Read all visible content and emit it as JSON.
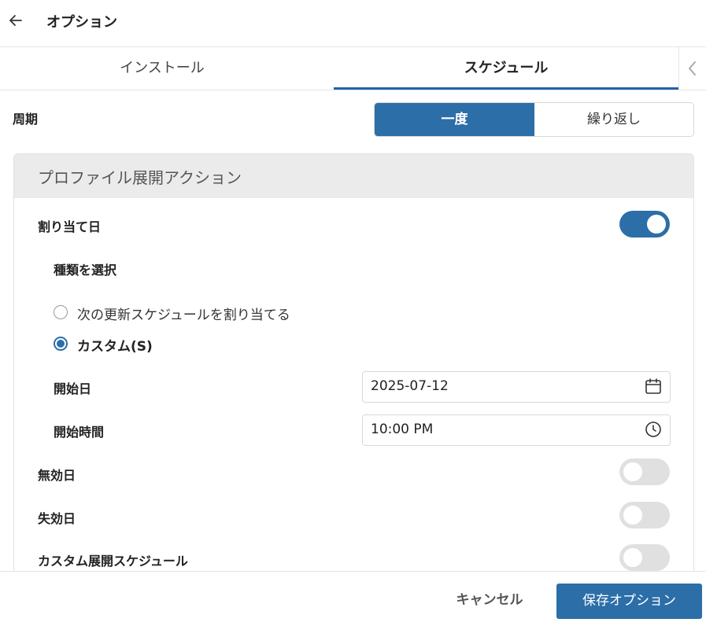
{
  "header": {
    "title": "オプション",
    "back_icon": "arrow-left-icon"
  },
  "tabs": [
    {
      "label": "インストール",
      "active": false
    },
    {
      "label": "スケジュール",
      "active": true
    }
  ],
  "tab_scroll_icon": "chevron-left-icon",
  "cycle": {
    "label": "周期",
    "options": [
      {
        "label": "一度",
        "selected": true
      },
      {
        "label": "繰り返し",
        "selected": false
      }
    ]
  },
  "panel": {
    "title": "プロファイル展開アクション",
    "assign_date": {
      "label": "割り当て日",
      "enabled": true
    },
    "type_select": {
      "label": "種類を選択",
      "options": [
        {
          "label": "次の更新スケジュールを割り当てる",
          "selected": false
        },
        {
          "label": "カスタム(S)",
          "selected": true
        }
      ]
    },
    "start_date": {
      "label": "開始日",
      "value": "2025-07-12",
      "icon": "calendar-icon"
    },
    "start_time": {
      "label": "開始時間",
      "value": "10:00 PM",
      "icon": "clock-icon"
    },
    "invalid_date": {
      "label": "無効日",
      "enabled": false
    },
    "expiry_date": {
      "label": "失効日",
      "enabled": false
    },
    "custom_schedule": {
      "label": "カスタム展開スケジュール",
      "enabled": false
    }
  },
  "footer": {
    "cancel_label": "キャンセル",
    "save_label": "保存オプション"
  },
  "colors": {
    "accent": "#2c6ea8",
    "tab_underline": "#2262a8",
    "toggle_off": "#e0e0e0",
    "panel_header": "#ebebeb"
  }
}
